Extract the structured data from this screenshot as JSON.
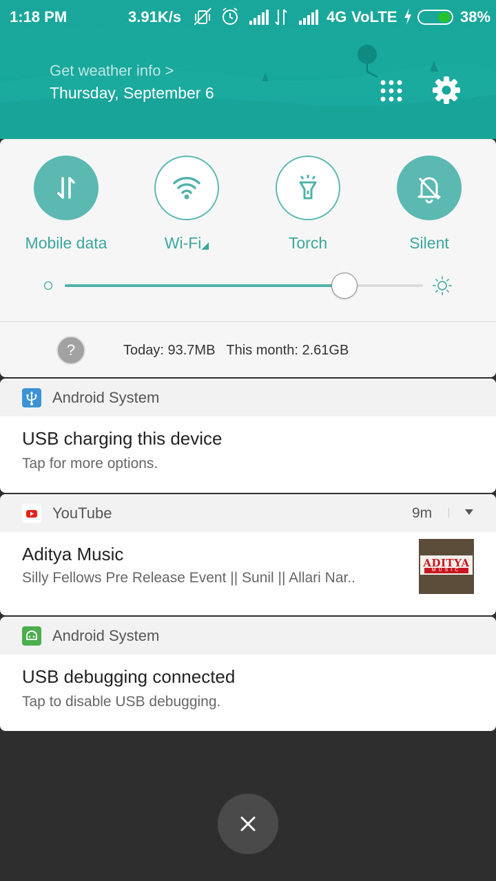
{
  "status_bar": {
    "time": "1:18 PM",
    "net_speed": "3.91K/s",
    "network_type": "4G",
    "volte": "VoLTE",
    "battery": "38%"
  },
  "header": {
    "weather_link": "Get weather info >",
    "date": "Thursday, September 6",
    "accent_color": "#1aa79b"
  },
  "quick_settings": {
    "toggles": [
      {
        "label": "Mobile data",
        "icon": "mobile-data-icon",
        "state": "on"
      },
      {
        "label": "Wi-Fi",
        "icon": "wifi-icon",
        "state": "off"
      },
      {
        "label": "Torch",
        "icon": "torch-icon",
        "state": "off"
      },
      {
        "label": "Silent",
        "icon": "silent-bell-icon",
        "state": "on"
      }
    ],
    "brightness_level": 0.78,
    "data_usage": {
      "today": "Today: 93.7MB",
      "month": "This month: 2.61GB"
    }
  },
  "notifications": [
    {
      "app": "Android System",
      "icon": "usb-icon",
      "title": "USB charging this device",
      "body": "Tap for more options."
    },
    {
      "app": "YouTube",
      "icon": "youtube-icon",
      "time": "9m",
      "title": "Aditya Music",
      "body": "Silly Fellows Pre Release Event || Sunil || Allari Nar..",
      "thumbnail_text": "ADITYA",
      "thumbnail_sub": "MUSIC"
    },
    {
      "app": "Android System",
      "icon": "android-icon",
      "title": "USB debugging connected",
      "body": "Tap to disable USB debugging."
    }
  ]
}
